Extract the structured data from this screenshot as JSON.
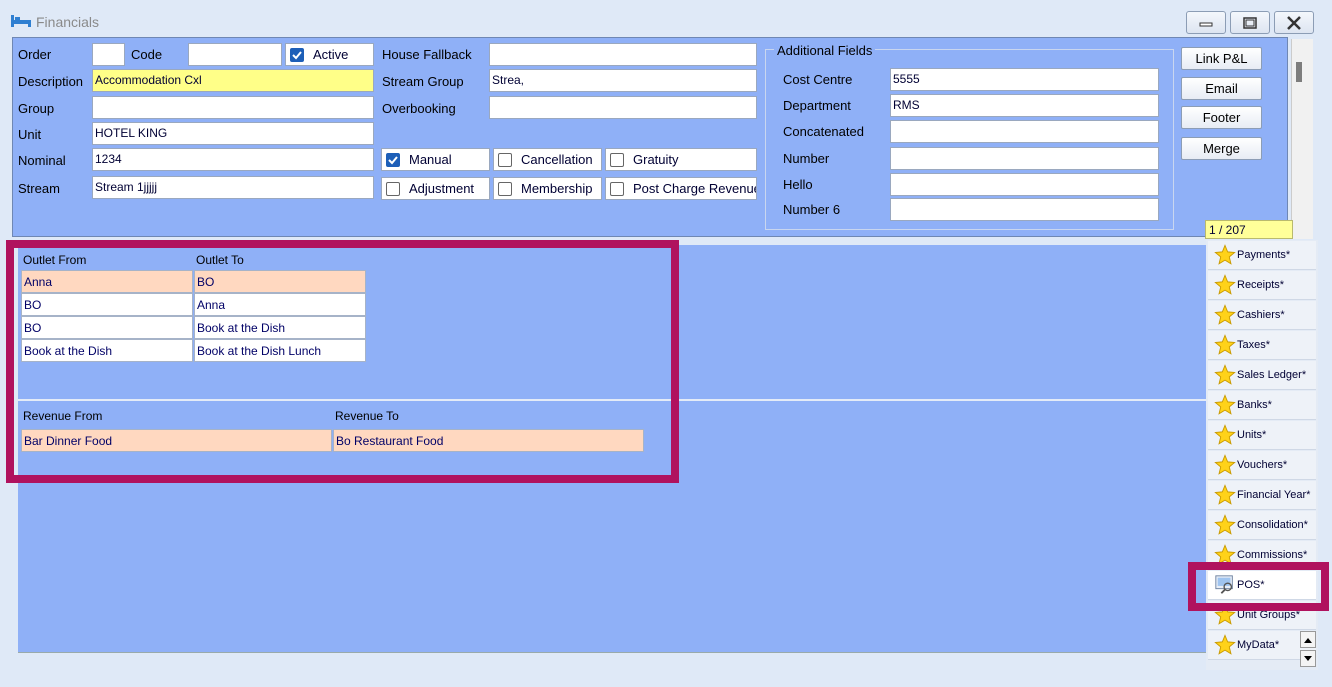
{
  "window": {
    "title": "Financials"
  },
  "form": {
    "order_label": "Order",
    "order_value": "",
    "code_label": "Code",
    "code_value": "",
    "active_label": "Active",
    "description_label": "Description",
    "description_value": "Accommodation Cxl",
    "group_label": "Group",
    "group_value": "",
    "unit_label": "Unit",
    "unit_value": "HOTEL KING",
    "nominal_label": "Nominal",
    "nominal_value": "1234",
    "stream_label": "Stream",
    "stream_value": "Stream 1jjjjj",
    "house_fallback_label": "House Fallback",
    "house_fallback_value": "",
    "stream_group_label": "Stream Group",
    "stream_group_value": "Strea,",
    "overbooking_label": "Overbooking",
    "overbooking_value": "",
    "checkboxes": {
      "manual": "Manual",
      "cancellation": "Cancellation",
      "gratuity": "Gratuity",
      "adjustment": "Adjustment",
      "membership": "Membership",
      "post_charge_revenue": "Post Charge Revenue"
    }
  },
  "additional_fields": {
    "legend": "Additional Fields",
    "cost_centre_label": "Cost Centre",
    "cost_centre_value": "5555",
    "department_label": "Department",
    "department_value": "RMS",
    "concatenated_label": "Concatenated",
    "concatenated_value": "",
    "number_label": "Number",
    "number_value": "",
    "hello_label": "Hello",
    "hello_value": "",
    "number6_label": "Number 6",
    "number6_value": ""
  },
  "side_buttons": {
    "link_pl": "Link P&L",
    "email": "Email",
    "footer": "Footer",
    "merge": "Merge"
  },
  "record_counter": "1 / 207",
  "outlet_grid": {
    "col_from": "Outlet From",
    "col_to": "Outlet To",
    "rows": [
      {
        "from": "Anna",
        "to": "BO"
      },
      {
        "from": "BO",
        "to": "Anna"
      },
      {
        "from": "BO",
        "to": "Book at the Dish"
      },
      {
        "from": "Book at the Dish",
        "to": "Book at the Dish Lunch"
      }
    ]
  },
  "revenue_grid": {
    "col_from": "Revenue From",
    "col_to": "Revenue To",
    "rows": [
      {
        "from": "Bar Dinner Food",
        "to": "Bo Restaurant Food"
      }
    ]
  },
  "nav": {
    "items": [
      "Payments*",
      "Receipts*",
      "Cashiers*",
      "Taxes*",
      "Sales Ledger*",
      "Banks*",
      "Units*",
      "Vouchers*",
      "Financial Year*",
      "Consolidation*",
      "Commissions*",
      "POS*",
      "Unit Groups*",
      "MyData*"
    ]
  },
  "colors": {
    "panel": "#8fb0f7",
    "highlight": "#b0125e",
    "selected_row": "#ffd8c0",
    "description_bg": "#ffff88"
  }
}
